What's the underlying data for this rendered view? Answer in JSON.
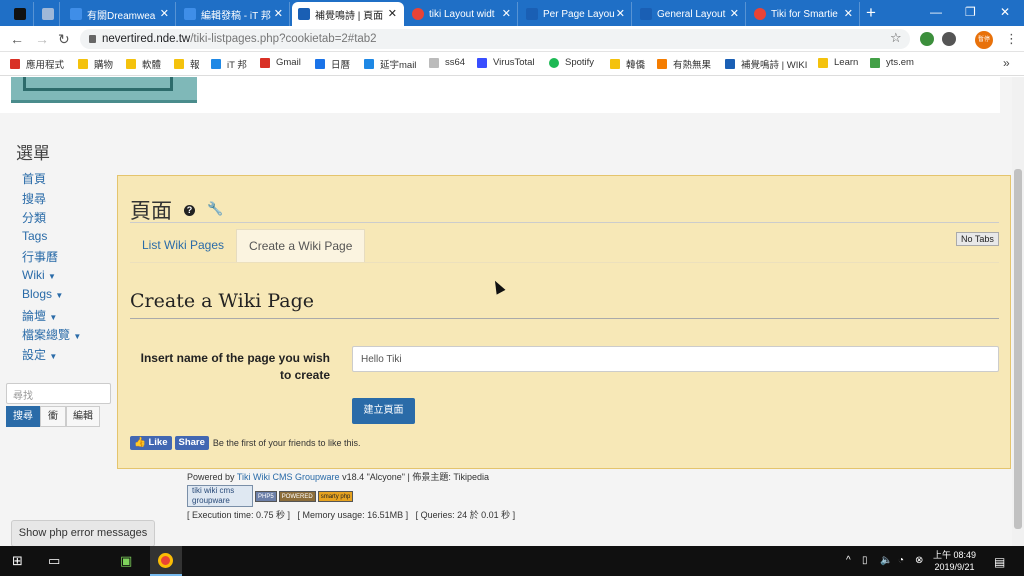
{
  "browser": {
    "tabs": [
      {
        "label": "有關Dreamwea",
        "color": "#3f8ee8"
      },
      {
        "label": "編輯發稿 - iT 邦",
        "color": "#3f8ee8"
      },
      {
        "label": "補覺鳴詩 | 頁面",
        "color": "#1a5fb4",
        "active": true
      },
      {
        "label": "tiki Layout widt",
        "color": "#ea4335"
      },
      {
        "label": "Per Page Layou",
        "color": "#1a5fb4"
      },
      {
        "label": "General Layout",
        "color": "#1a5fb4"
      },
      {
        "label": "Tiki for Smartie",
        "color": "#ea4335"
      }
    ],
    "new_tab": "+",
    "address": {
      "host": "nevertired.nde.tw",
      "path": "/tiki-listpages.php?cookietab=2#tab2"
    },
    "profile_label": "暫停",
    "bookmarks": [
      {
        "label": "應用程式",
        "color": "#d93025"
      },
      {
        "label": "購物",
        "color": "#f4c20d"
      },
      {
        "label": "軟體",
        "color": "#f4c20d"
      },
      {
        "label": "報",
        "color": "#f4c20d"
      },
      {
        "label": "iT 邦",
        "color": "#1e88e5"
      },
      {
        "label": "Gmail",
        "color": "#d93025"
      },
      {
        "label": "日曆",
        "color": "#1a73e8"
      },
      {
        "label": "延宇mail",
        "color": "#1e88e5"
      },
      {
        "label": "ss64",
        "color": "#bbbbbb"
      },
      {
        "label": "VirusTotal",
        "color": "#394eff"
      },
      {
        "label": "Spotify",
        "color": "#1db954"
      },
      {
        "label": "韓僑",
        "color": "#f4c20d"
      },
      {
        "label": "有熱無果",
        "color": "#f57d00"
      },
      {
        "label": "補覺鳴詩 | WIKI",
        "color": "#1a5fb4"
      },
      {
        "label": "Learn",
        "color": "#f4c20d"
      },
      {
        "label": "yts.em",
        "color": "#43a047"
      }
    ]
  },
  "sidebar": {
    "title": "選單",
    "items": [
      "首頁",
      "搜尋",
      "分類",
      "Tags",
      "行事曆",
      "Wiki",
      "Blogs",
      "論壇",
      "檔案總覽",
      "設定"
    ],
    "has_caret": [
      false,
      false,
      false,
      false,
      false,
      true,
      true,
      true,
      true,
      true
    ],
    "search_placeholder": "尋找",
    "search_btn": "搜尋",
    "btn2": "衝",
    "btn3": "編輯",
    "error_btn": "Show php error messages"
  },
  "main": {
    "page_title": "頁面",
    "tabs": [
      "List Wiki Pages",
      "Create a Wiki Page"
    ],
    "no_tabs": "No Tabs",
    "heading": "Create a Wiki Page",
    "field_label": "Insert name of the page you wish to create",
    "field_value": "Hello Tiki",
    "create_btn": "建立頁面",
    "fb_like": "Like",
    "fb_share": "Share",
    "fb_text": "Be the first of your friends to like this."
  },
  "footer": {
    "powered_prefix": "Powered by",
    "powered_link": "Tiki Wiki CMS Groupware",
    "powered_suffix": "v18.4 \"Alcyone\" | 佈景主題: Tikipedia",
    "tiki_badge": "tiki wiki cms groupware",
    "php_badge": "PHP5",
    "powered_badge": "POWERED",
    "smarty_badge": "smarty php",
    "perf": "[ Execution time: 0.75 秒 ]   [ Memory usage: 16.51MB ]   [ Queries: 24 於 0.01 秒 ]"
  },
  "taskbar": {
    "time": "上午 08:49",
    "date": "2019/9/21"
  }
}
